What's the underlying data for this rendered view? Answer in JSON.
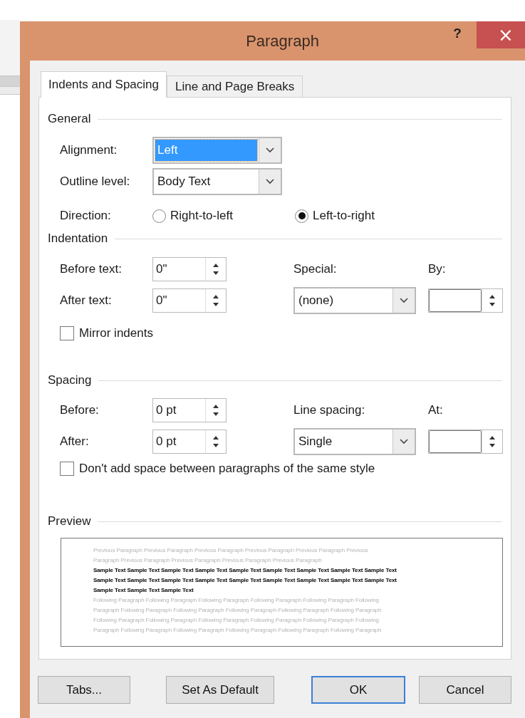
{
  "window": {
    "title": "Paragraph",
    "help": "?",
    "close": "×"
  },
  "tabs": [
    {
      "label": "Indents and Spacing",
      "selected": true
    },
    {
      "label": "Line and Page Breaks",
      "selected": false
    }
  ],
  "general": {
    "heading": "General",
    "alignment": {
      "label": "Alignment:",
      "value": "Left",
      "highlighted": true
    },
    "outline_level": {
      "label": "Outline level:",
      "value": "Body Text",
      "highlighted": false
    },
    "direction": {
      "label": "Direction:",
      "options": [
        {
          "label": "Right-to-left",
          "selected": false
        },
        {
          "label": "Left-to-right",
          "selected": true
        }
      ]
    }
  },
  "indentation": {
    "heading": "Indentation",
    "before_text": {
      "label": "Before text:",
      "value": "0\""
    },
    "after_text": {
      "label": "After text:",
      "value": "0\""
    },
    "special": {
      "label": "Special:",
      "value": "(none)"
    },
    "by": {
      "label": "By:"
    },
    "mirror_indents": {
      "label": "Mirror indents",
      "checked": false
    }
  },
  "spacing": {
    "heading": "Spacing",
    "before": {
      "label": "Before:",
      "value": "0 pt"
    },
    "after": {
      "label": "After:",
      "value": "0 pt"
    },
    "line_spacing": {
      "label": "Line spacing:",
      "value": "Single"
    },
    "at": {
      "label": "At:"
    },
    "dont_add_space": {
      "label": "Don't add space between paragraphs of the same style",
      "checked": false
    }
  },
  "preview": {
    "heading": "Preview",
    "lines": [
      {
        "kind": "previous",
        "text": "Previous Paragraph Previous Paragraph Previous Paragraph Previous Paragraph Previous Paragraph Previous"
      },
      {
        "kind": "previous",
        "text": "Paragraph Previous Paragraph Previous Paragraph Previous Paragraph Previous Paragraph"
      },
      {
        "kind": "sample",
        "text": "Sample Text Sample Text Sample Text Sample Text Sample Text Sample Text Sample Text Sample Text Sample Text"
      },
      {
        "kind": "sample",
        "text": "Sample Text Sample Text Sample Text Sample Text Sample Text Sample Text Sample Text Sample Text Sample Text"
      },
      {
        "kind": "sample",
        "text": "Sample Text Sample Text Sample Text"
      },
      {
        "kind": "following",
        "text": "Following Paragraph Following Paragraph Following Paragraph Following Paragraph Following Paragraph Following"
      },
      {
        "kind": "following",
        "text": "Paragraph Following Paragraph Following Paragraph Following Paragraph Following Paragraph Following Paragraph"
      },
      {
        "kind": "following",
        "text": "Following Paragraph Following Paragraph Following Paragraph Following Paragraph Following Paragraph Following"
      },
      {
        "kind": "following",
        "text": "Paragraph Following Paragraph Following Paragraph Following Paragraph Following Paragraph Following Paragraph"
      }
    ]
  },
  "buttons": [
    {
      "label": "Tabs...",
      "default": false
    },
    {
      "label": "Set As Default",
      "default": false
    },
    {
      "label": "OK",
      "default": true
    },
    {
      "label": "Cancel",
      "default": false
    }
  ]
}
